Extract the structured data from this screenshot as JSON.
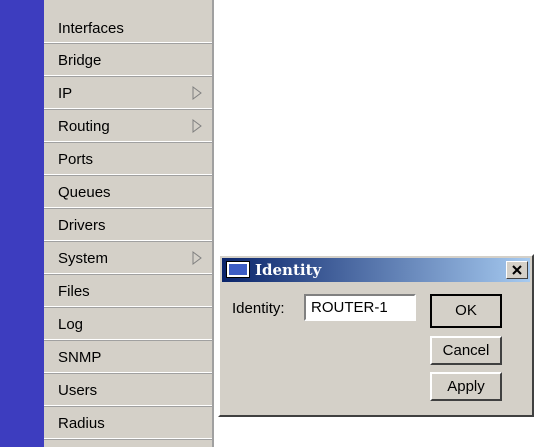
{
  "menu": {
    "items": [
      {
        "label": "Interfaces",
        "submenu": false
      },
      {
        "label": "Bridge",
        "submenu": false
      },
      {
        "label": "IP",
        "submenu": true
      },
      {
        "label": "Routing",
        "submenu": true
      },
      {
        "label": "Ports",
        "submenu": false
      },
      {
        "label": "Queues",
        "submenu": false
      },
      {
        "label": "Drivers",
        "submenu": false
      },
      {
        "label": "System",
        "submenu": true
      },
      {
        "label": "Files",
        "submenu": false
      },
      {
        "label": "Log",
        "submenu": false
      },
      {
        "label": "SNMP",
        "submenu": false
      },
      {
        "label": "Users",
        "submenu": false
      },
      {
        "label": "Radius",
        "submenu": false
      }
    ]
  },
  "dialog": {
    "title": "Identity",
    "field_label": "Identity:",
    "field_value": "ROUTER-1",
    "ok_label": "OK",
    "cancel_label": "Cancel",
    "apply_label": "Apply",
    "close_icon": "close-icon"
  },
  "colors": {
    "sidebar_strip": "#3d3dbf",
    "titlebar_start": "#0a246a",
    "titlebar_end": "#a6caf0",
    "face": "#d4d0c8"
  }
}
